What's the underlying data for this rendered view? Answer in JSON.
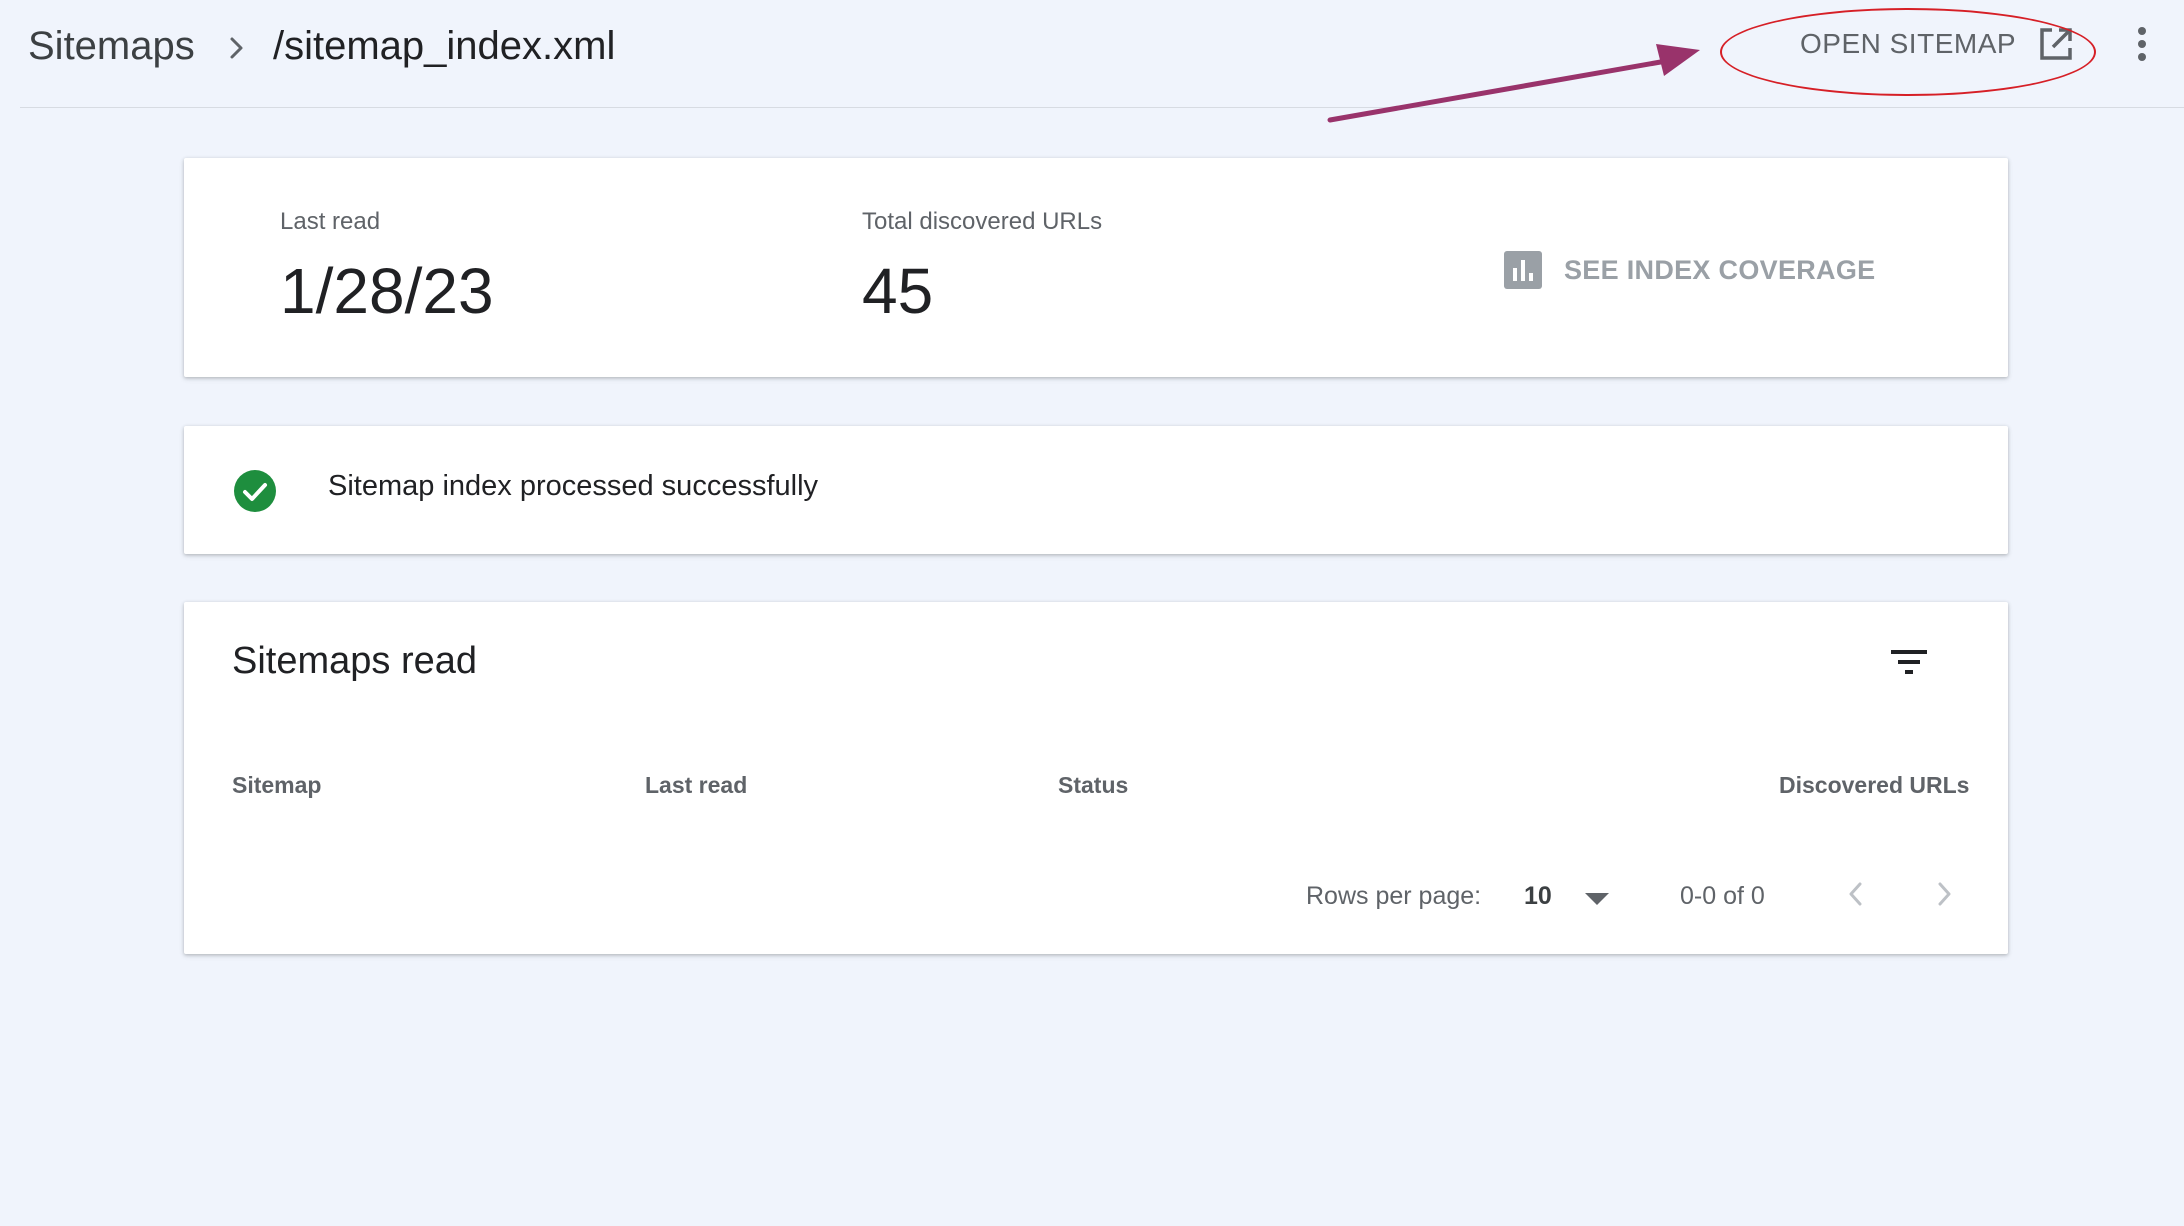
{
  "breadcrumb": {
    "root": "Sitemaps",
    "separator_icon": "chevron-right-icon",
    "current": "/sitemap_index.xml"
  },
  "toolbar": {
    "open_sitemap_label": "OPEN SITEMAP",
    "open_sitemap_icon": "open-in-new-icon",
    "more_icon": "more-vertical-icon"
  },
  "stats": {
    "last_read_label": "Last read",
    "last_read_value": "1/28/23",
    "total_urls_label": "Total discovered URLs",
    "total_urls_value": "45",
    "coverage_label": "SEE INDEX COVERAGE",
    "coverage_icon": "bar-chart-icon"
  },
  "status": {
    "icon": "check-circle-icon",
    "text": "Sitemap index processed successfully"
  },
  "table": {
    "title": "Sitemaps read",
    "filter_icon": "filter-icon",
    "columns": [
      "Sitemap",
      "Last read",
      "Status",
      "Discovered URLs"
    ],
    "rows": [],
    "pagination": {
      "rows_per_page_label": "Rows per page:",
      "rows_per_page_value": "10",
      "range": "0-0 of 0"
    }
  },
  "colors": {
    "background": "#f0f4fc",
    "success": "#1e8e3e",
    "annotation_ellipse": "#d61f26",
    "annotation_arrow": "#99336b",
    "muted_text": "#5f6368",
    "disabled_text": "#9aa0a6"
  }
}
